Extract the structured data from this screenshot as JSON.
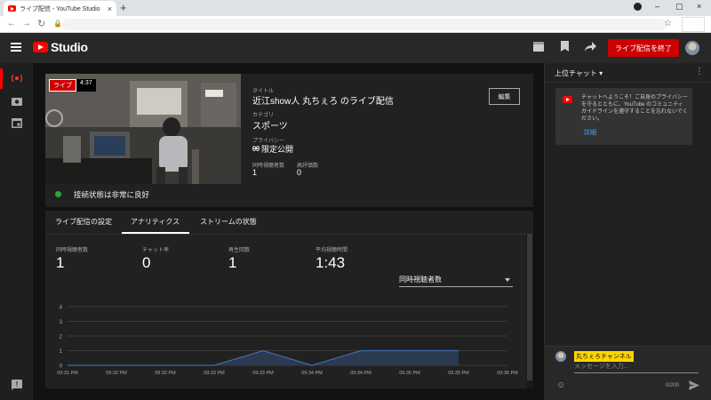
{
  "browser": {
    "tab_title": "ライブ配信 - YouTube Studio",
    "new_tab_label": "+",
    "close_tab": "×",
    "window_controls": [
      "–",
      "▢",
      "×"
    ]
  },
  "header": {
    "logo_text": "Studio",
    "end_stream_label": "ライブ配信を終了"
  },
  "stream": {
    "live_label": "ライブ",
    "duration": "4:37",
    "title_label": "タイトル",
    "title": "近江show人 丸ちぇろ のライブ配信",
    "category_label": "カテゴリ",
    "category": "スポーツ",
    "privacy_label": "プライバシー",
    "privacy": "限定公開",
    "viewers_label": "同時視聴者数",
    "viewers": "1",
    "likes_label": "高評価数",
    "likes": "0",
    "edit_label": "編集",
    "connection_status": "接続状態は非常に良好",
    "status_color": "#2ba640"
  },
  "tabs": [
    {
      "label": "ライブ配信の設定"
    },
    {
      "label": "アナリティクス"
    },
    {
      "label": "ストリームの状態"
    }
  ],
  "stats": [
    {
      "label": "同時視聴者数",
      "value": "1"
    },
    {
      "label": "チャット率",
      "value": "0"
    },
    {
      "label": "再生回数",
      "value": "1"
    },
    {
      "label": "平均視聴時間",
      "value": "1:43"
    }
  ],
  "metric_select": "同時視聴者数",
  "chart_data": {
    "type": "area",
    "x": [
      "09:31 PM",
      "09:32 PM",
      "09:32 PM",
      "09:33 PM",
      "09:33 PM",
      "09:34 PM",
      "09:34 PM",
      "09:35 PM",
      "09:35 PM",
      "09:36 PM"
    ],
    "values": [
      0,
      0,
      0,
      0,
      1,
      0,
      1,
      1,
      1,
      null
    ],
    "ylim": [
      0,
      4
    ],
    "yticks": [
      "0",
      "1",
      "2",
      "3",
      "4"
    ],
    "grid": true,
    "line_color": "#3d6ba8",
    "fill_color": "#2d3e57"
  },
  "chat": {
    "header": "上位チャット",
    "welcome": "チャットへようこそ！ご自身のプライバシーを守るとともに、YouTube のコミュニティ ガイドラインを遵守することを忘れないでください。",
    "details_link": "詳細",
    "username": "丸ちぇろチャンネル",
    "placeholder": "メッセージを入力...",
    "counter": "0/200"
  },
  "colors": {
    "accent_red": "#cc0000",
    "link_blue": "#3ea6ff"
  }
}
